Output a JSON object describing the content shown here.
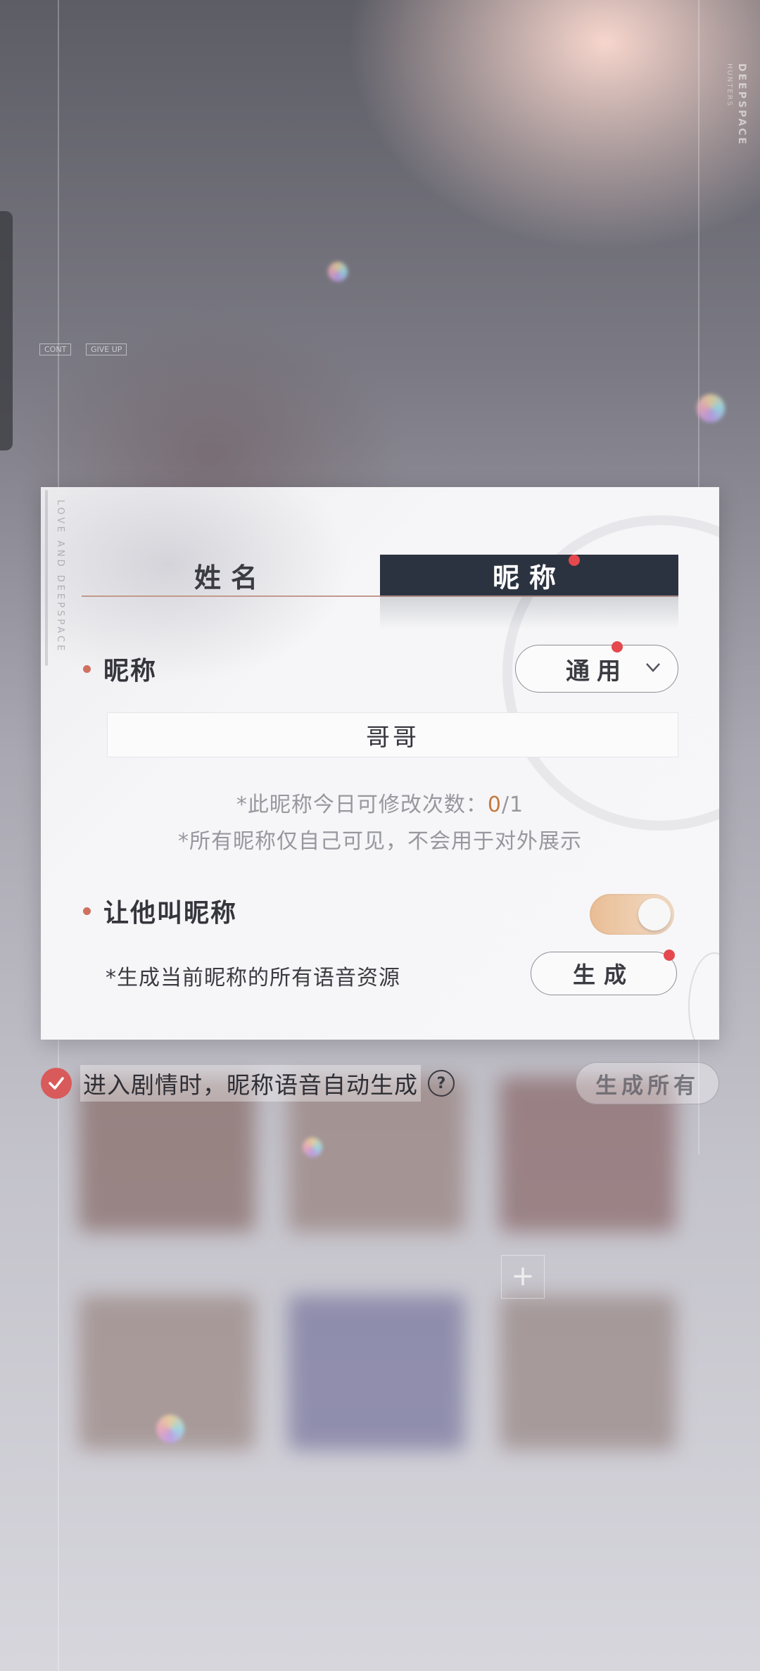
{
  "background": {
    "brand": "DEEPSPACE",
    "brand_sub": "HUNTERS",
    "chips": [
      "CONT",
      "GIVE UP"
    ]
  },
  "dialog": {
    "side_text": "LOVE AND DEEPSPACE",
    "tabs": [
      {
        "label": "姓名",
        "active": false
      },
      {
        "label": "昵称",
        "active": true,
        "has_dot": true
      }
    ],
    "nickname_section": {
      "title": "昵称",
      "dropdown_value": "通用",
      "dropdown_icon": "chevron-down-icon",
      "input_value": "哥哥",
      "hint_prefix": "*此昵称今日可修改次数：",
      "hint_used": "0",
      "hint_total": "/1",
      "hint_visibility": "*所有昵称仅自己可见，不会用于对外展示"
    },
    "call_section": {
      "title": "让他叫昵称",
      "toggle_on": true,
      "generate_label": "*生成当前昵称的所有语音资源",
      "generate_button": "生成"
    }
  },
  "footer": {
    "auto_generate_checked": true,
    "auto_generate_label": "进入剧情时，昵称语音自动生成",
    "help_icon": "?",
    "generate_all_button": "生成所有"
  },
  "colors": {
    "active_tab_bg": "#2c3340",
    "accent_dot": "#e5484d",
    "bullet": "#d0705f",
    "toggle_on": "#e9bd95",
    "count_highlight": "#c67a3e",
    "checkbox": "#d95a5a"
  }
}
